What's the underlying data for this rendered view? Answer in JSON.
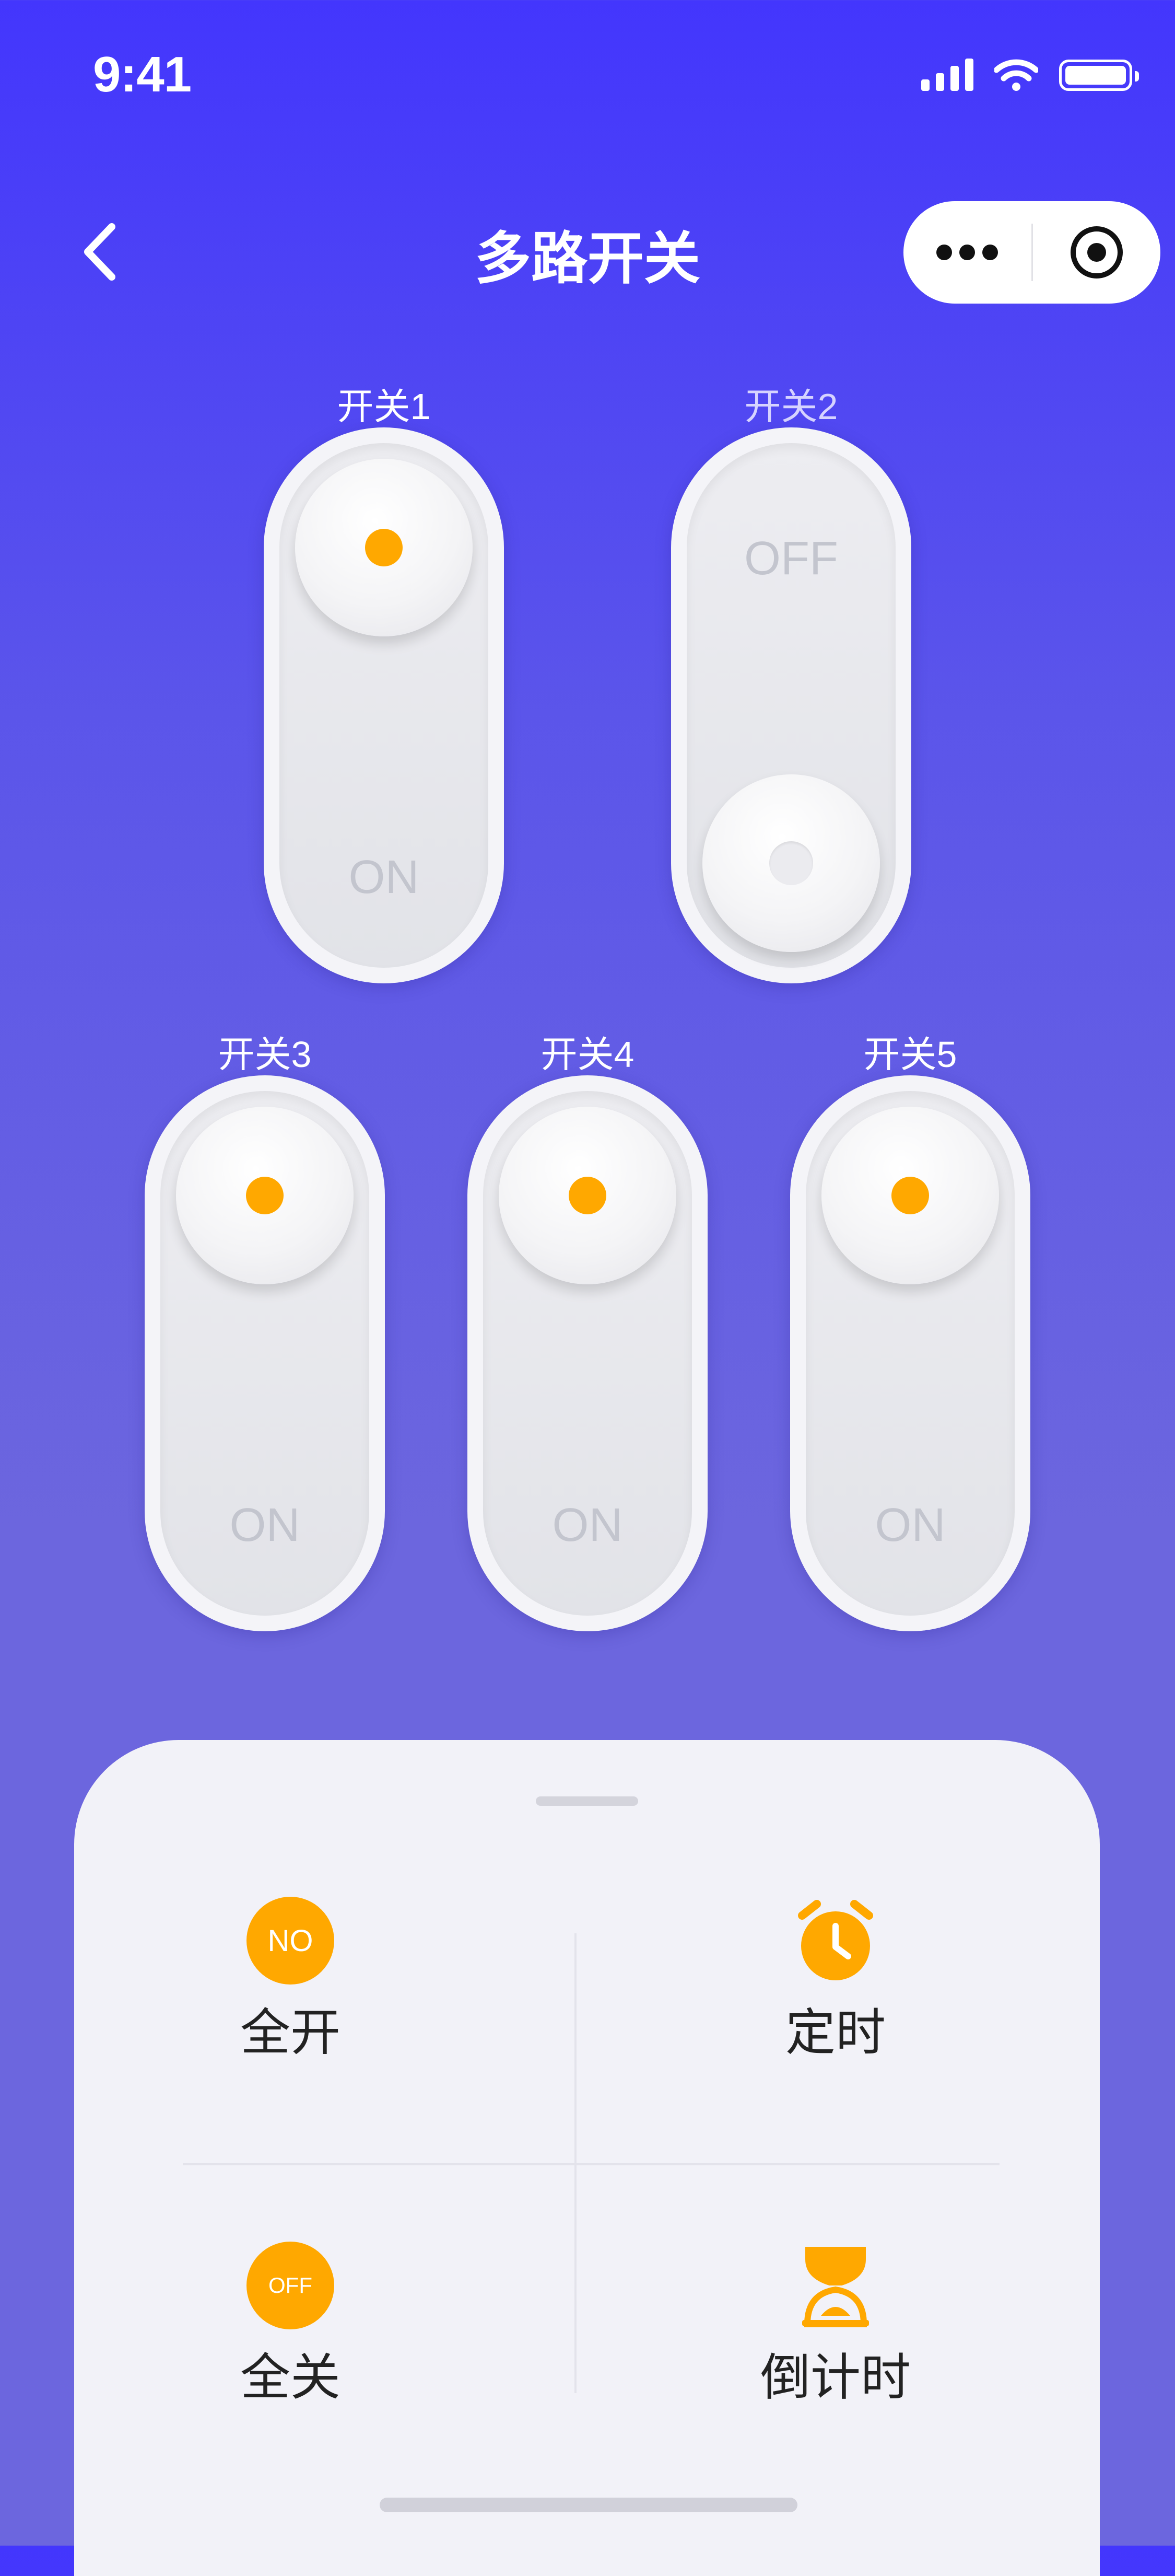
{
  "status_bar": {
    "time": "9:41",
    "icons": [
      "signal-icon",
      "wifi-icon",
      "battery-icon"
    ]
  },
  "nav": {
    "title": "多路开关",
    "back_icon": "chevron-left-icon",
    "menu_icon": "more-dots-icon",
    "close_icon": "target-icon"
  },
  "switches": [
    {
      "label": "开关1",
      "state": "ON",
      "on": true
    },
    {
      "label": "开关2",
      "state": "OFF",
      "on": false
    },
    {
      "label": "开关3",
      "state": "ON",
      "on": true
    },
    {
      "label": "开关4",
      "state": "ON",
      "on": true
    },
    {
      "label": "开关5",
      "state": "ON",
      "on": true
    }
  ],
  "actions": {
    "all_on": {
      "icon_text": "NO",
      "label": "全开"
    },
    "timer": {
      "icon": "alarm-clock-icon",
      "label": "定时"
    },
    "all_off": {
      "icon_text": "OFF",
      "label": "全关"
    },
    "countdown": {
      "icon": "hourglass-icon",
      "label": "倒计时"
    }
  },
  "colors": {
    "accent": "#FFA800",
    "background_top": "#4336FD",
    "background_bottom": "#6C66DE",
    "panel": "#F2F2F8"
  }
}
